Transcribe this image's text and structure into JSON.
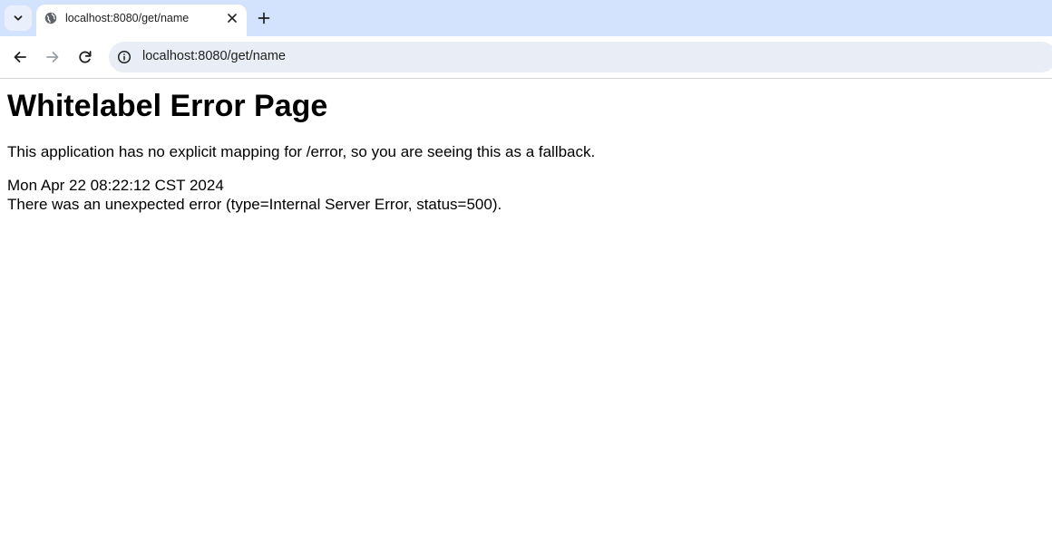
{
  "browser": {
    "tab": {
      "title": "localhost:8080/get/name"
    },
    "address_bar": {
      "url": "localhost:8080/get/name"
    },
    "icons": {
      "tab_search": "chevron-down-icon",
      "favicon": "globe-icon",
      "tab_close": "close-icon",
      "new_tab": "plus-icon",
      "back": "back-arrow-icon",
      "forward": "forward-arrow-icon",
      "reload": "reload-icon",
      "site_info": "info-icon"
    }
  },
  "page": {
    "heading": "Whitelabel Error Page",
    "message": "This application has no explicit mapping for /error, so you are seeing this as a fallback.",
    "timestamp": "Mon Apr 22 08:22:12 CST 2024",
    "error_detail": "There was an unexpected error (type=Internal Server Error, status=500)."
  }
}
